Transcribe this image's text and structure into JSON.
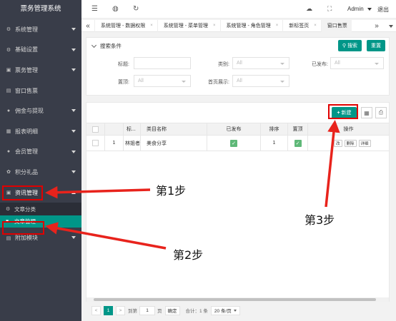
{
  "app": {
    "title": "票务管理系统"
  },
  "sidebar": {
    "items": [
      {
        "label": "系统管理",
        "icon": "gear-icon",
        "glyph": "⚙"
      },
      {
        "label": "基础设置",
        "icon": "settings-icon",
        "glyph": "⚙"
      },
      {
        "label": "票务管理",
        "icon": "ticket-icon",
        "glyph": "▣"
      },
      {
        "label": "窗口售票",
        "icon": "window-icon",
        "glyph": "▤"
      },
      {
        "label": "佣金与提现",
        "icon": "money-icon",
        "glyph": "●"
      },
      {
        "label": "报表明细",
        "icon": "report-icon",
        "glyph": "▦"
      },
      {
        "label": "会员管理",
        "icon": "user-icon",
        "glyph": "●"
      },
      {
        "label": "积分礼品",
        "icon": "gift-icon",
        "glyph": "✿"
      },
      {
        "label": "资讯管理",
        "icon": "news-icon",
        "glyph": "▣"
      }
    ],
    "sub_items": [
      {
        "label": "文章分类",
        "icon": "category-icon",
        "glyph": "⚙"
      },
      {
        "label": "文章管理",
        "icon": "heart-icon",
        "glyph": "♥"
      }
    ],
    "last_item": {
      "label": "附加模块",
      "icon": "addon-icon",
      "glyph": "▤"
    }
  },
  "header": {
    "menu_icon": "☰",
    "globe_icon": "◍",
    "refresh_icon": "↻",
    "theme_icon": "☁",
    "fullscreen_icon": "⛶",
    "user": "Admin",
    "logout": "退出"
  },
  "tabs": {
    "prev": "«",
    "next": "»",
    "items": [
      {
        "label": "系统管理 - 数据权限"
      },
      {
        "label": "系统管理 - 菜单管理"
      },
      {
        "label": "系统管理 - 角色管理"
      },
      {
        "label": "新标签页"
      },
      {
        "label": "窗口售票"
      }
    ],
    "close": "×"
  },
  "search": {
    "title": "搜索条件",
    "search_button": "搜索",
    "reset_button": "重置",
    "fields": {
      "title_label": "标题:",
      "category_label": "类别:",
      "category_value": "All",
      "published_label": "已发布:",
      "published_value": "All",
      "top_label": "置顶:",
      "top_value": "All",
      "home_label": "首页展示:",
      "home_value": "All"
    }
  },
  "table": {
    "new_button": "新建",
    "columns": [
      "标...",
      "类目名称",
      "已发布",
      "排序",
      "置顶",
      "操作"
    ],
    "rows": [
      {
        "index": "1",
        "title": "林姐者!",
        "category": "美食分享",
        "published": "✓",
        "order": "1",
        "top": "✓",
        "actions": [
          "改",
          "删除",
          "详细"
        ]
      }
    ]
  },
  "pager": {
    "prev": "<",
    "current": "1",
    "next": ">",
    "goto_label": "到第",
    "goto_value": "1",
    "page_unit": "页",
    "confirm": "确定",
    "total": "合计：1 条",
    "page_size": "20 条/页"
  },
  "annotations": {
    "step1": "第1步",
    "step2": "第2步",
    "step3": "第3步",
    "arrow_color": "#e8231c"
  }
}
